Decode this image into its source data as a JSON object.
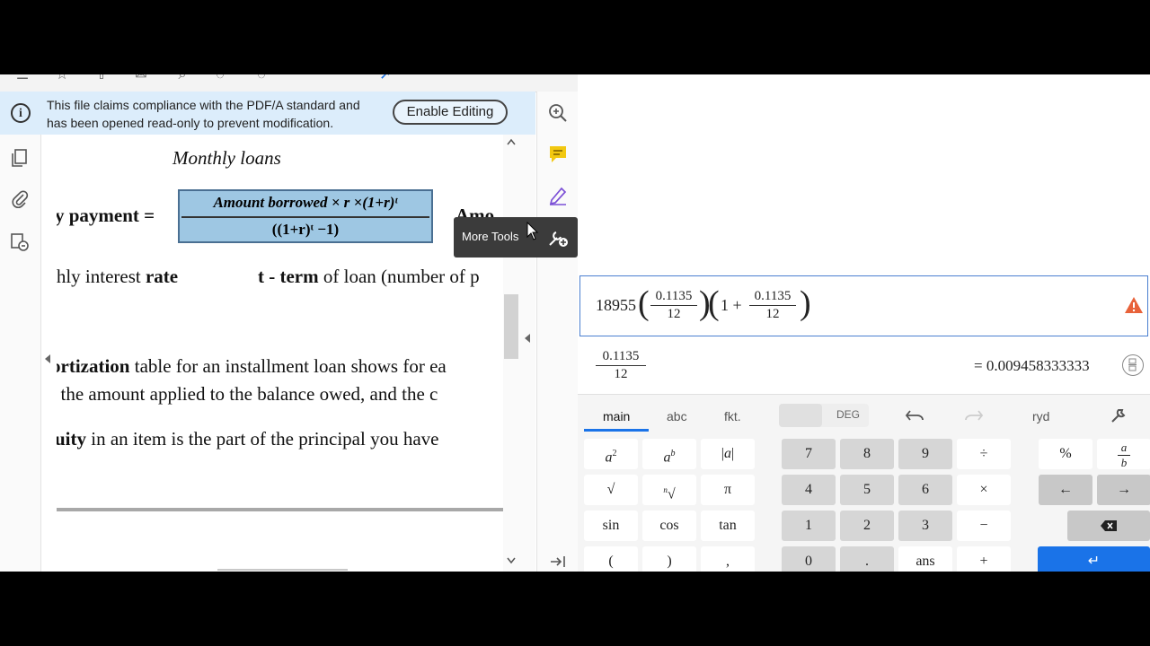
{
  "banner": {
    "text_line1": "This file claims compliance with the PDF/A standard and",
    "text_line2": "has been opened read-only to prevent modification.",
    "enable_button": "Enable Editing"
  },
  "document": {
    "title": "Monthly loans",
    "payment_label": "y payment =",
    "formula_numerator": "Amount borrowed × r ×(1+r)ᵗ",
    "formula_denominator": "((1+r)ᵗ −1)",
    "amo_fragment": "Amo",
    "interest_prefix": "thly interest ",
    "interest_bold": "rate",
    "term_bold": "t - term",
    "term_rest": " of loan (number of p",
    "amort_bold": "ortization",
    "amort_rest": " table for an installment loan shows for ea",
    "amort_line2": ", the amount applied to the balance owed, and the c",
    "equity_bold": "uity",
    "equity_rest": " in an item is the part of the principal you have"
  },
  "tooltip": {
    "label": "More Tools"
  },
  "calculator": {
    "input": {
      "lead": "18955",
      "frac1_num": "0.1135",
      "frac1_den": "12",
      "one_plus": "1 +",
      "frac2_num": "0.1135",
      "frac2_den": "12"
    },
    "result": {
      "frac_num": "0.1135",
      "frac_den": "12",
      "value": "= 0.009458333333"
    },
    "tabs": {
      "main": "main",
      "abc": "abc",
      "fkt": "fkt.",
      "deg": "DEG",
      "ryd": "ryd"
    },
    "keys": {
      "sqrt": "√",
      "pi": "π",
      "sin": "sin",
      "cos": "cos",
      "tan": "tan",
      "lparen": "(",
      "rparen": ")",
      "comma": ",",
      "n7": "7",
      "n8": "8",
      "n9": "9",
      "div": "÷",
      "n4": "4",
      "n5": "5",
      "n6": "6",
      "mul": "×",
      "n1": "1",
      "n2": "2",
      "n3": "3",
      "minus": "−",
      "n0": "0",
      "dot": ".",
      "ans": "ans",
      "plus": "+",
      "percent": "%",
      "left": "←",
      "right": "→",
      "enter": "↵"
    }
  },
  "colors": {
    "accent": "#1a73e8",
    "banner_bg": "#dcedfb",
    "formula_bg": "#9ec7e3",
    "warning": "#e8623a"
  }
}
